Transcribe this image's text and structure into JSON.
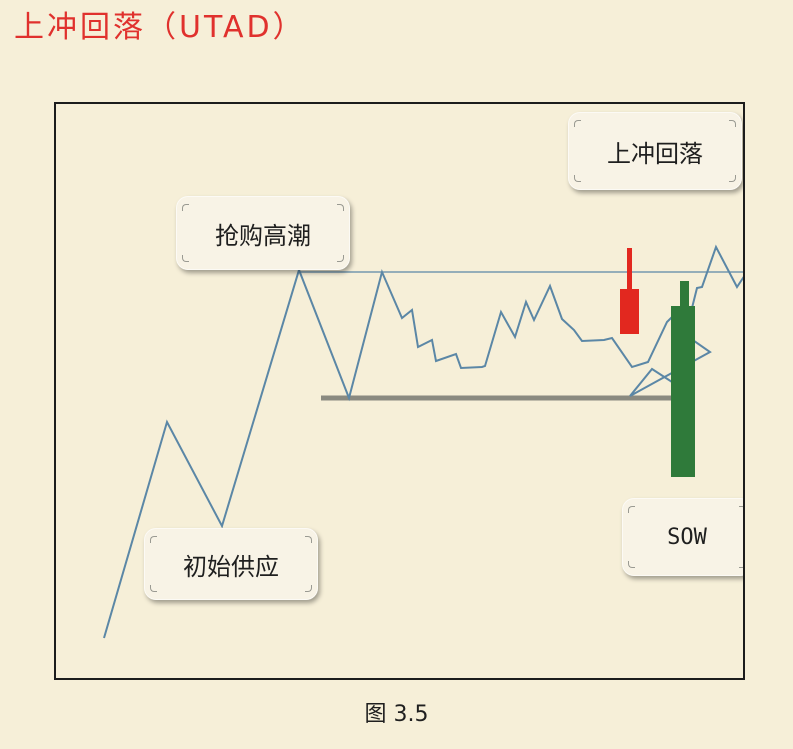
{
  "page": {
    "title": "上冲回落（UTAD）",
    "caption": "图 3.5"
  },
  "diagram": {
    "labels": {
      "upthrust": "上冲回落",
      "buying_climax": "抢购高潮",
      "preliminary_supply": "初始供应",
      "sow": "SOW"
    }
  },
  "colors": {
    "background": "#f6efd8",
    "title": "#e0312d",
    "price_line": "#5b87a6",
    "resistance_line": "#5b87a6",
    "support_line": "#8a8a80",
    "bear_candle": "#e2281f",
    "bull_candle": "#2f7a3a",
    "frame_border": "#1c1c1c"
  }
}
